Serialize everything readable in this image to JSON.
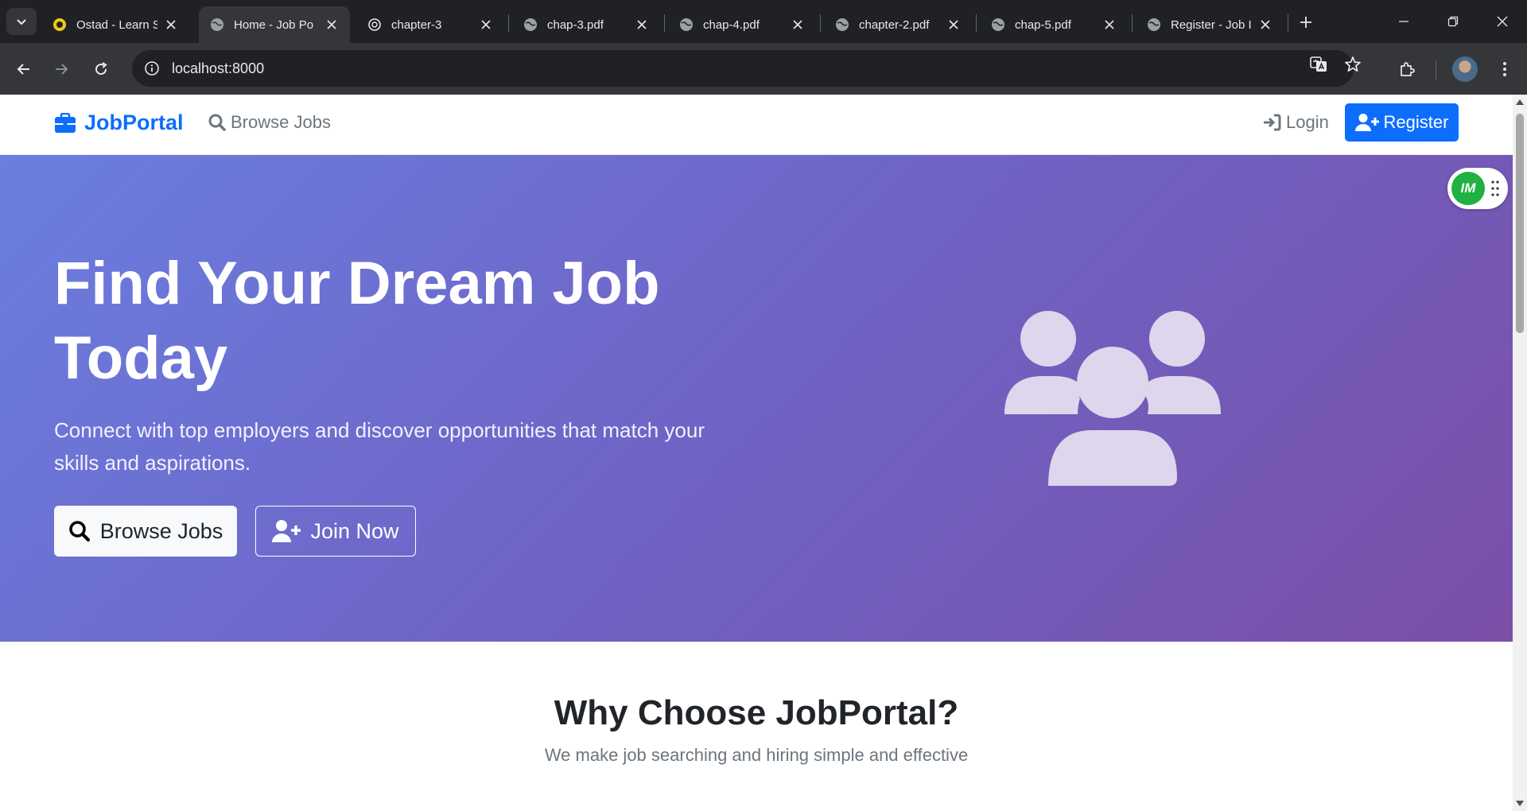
{
  "browser": {
    "tabs": [
      {
        "title": "Ostad - Learn S",
        "active": false
      },
      {
        "title": "Home - Job Po",
        "active": true
      },
      {
        "title": "chapter-3",
        "active": false
      },
      {
        "title": "chap-3.pdf",
        "active": false
      },
      {
        "title": "chap-4.pdf",
        "active": false
      },
      {
        "title": "chapter-2.pdf",
        "active": false
      },
      {
        "title": "chap-5.pdf",
        "active": false
      },
      {
        "title": "Register - Job I",
        "active": false
      }
    ],
    "url": "localhost:8000"
  },
  "navbar": {
    "brand": "JobPortal",
    "browse_jobs": "Browse Jobs",
    "login": "Login",
    "register": "Register"
  },
  "hero": {
    "title_line1": "Find Your Dream Job",
    "title_line2": "Today",
    "subtitle_line1": "Connect with top employers and discover opportunities that match your",
    "subtitle_line2": "skills and aspirations.",
    "browse_button": "Browse Jobs",
    "join_button": "Join Now"
  },
  "extension_badge": {
    "logo_text": "IM"
  },
  "why": {
    "heading": "Why Choose JobPortal?",
    "subheading": "We make job searching and hiring simple and effective"
  },
  "colors": {
    "primary": "#0d6efd",
    "hero_gradient_start": "#6a7ee0",
    "hero_gradient_end": "#7a4fa8",
    "chrome_dark": "#202124",
    "chrome_toolbar": "#35363a"
  }
}
